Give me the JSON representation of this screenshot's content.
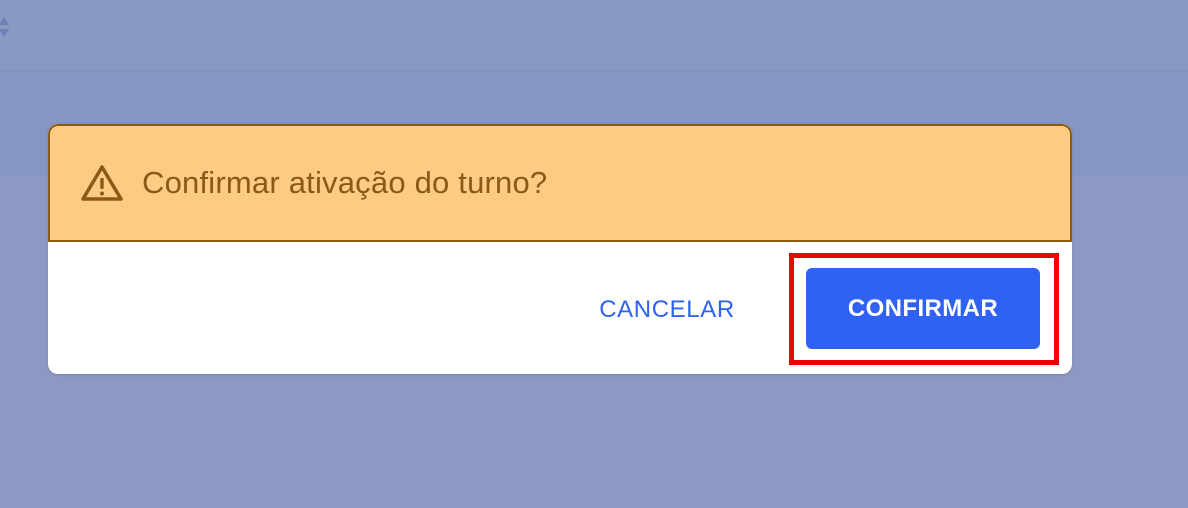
{
  "dialog": {
    "title": "Confirmar ativação do turno?",
    "icon": "warning-icon",
    "cancel_label": "CANCELAR",
    "confirm_label": "CONFIRMAR"
  },
  "top_bar": {
    "icon": "sort-icon"
  },
  "colors": {
    "overlay": "#8c99c3",
    "header_bg": "#fecb84",
    "header_text": "#8a5a14",
    "primary": "#2f62f2",
    "link": "#2d63f0",
    "highlight": "#ee0000"
  }
}
